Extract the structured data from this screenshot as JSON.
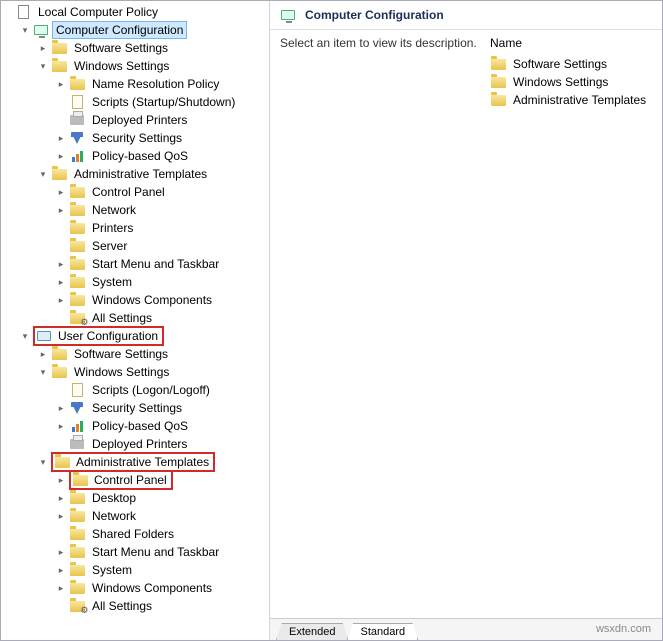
{
  "right_header": {
    "title": "Computer Configuration"
  },
  "right_body": {
    "description_prompt": "Select an item to view its description.",
    "name_header": "Name",
    "items": [
      {
        "label": "Software Settings"
      },
      {
        "label": "Windows Settings"
      },
      {
        "label": "Administrative Templates"
      }
    ]
  },
  "tabs": {
    "extended": "Extended",
    "standard": "Standard"
  },
  "watermark": "wsxdn.com",
  "tree": {
    "root": {
      "label": "Local Computer Policy"
    },
    "computer_config": {
      "label": "Computer Configuration"
    },
    "cc_software": {
      "label": "Software Settings"
    },
    "cc_windows": {
      "label": "Windows Settings"
    },
    "cc_ws_nrp": {
      "label": "Name Resolution Policy"
    },
    "cc_ws_scripts": {
      "label": "Scripts (Startup/Shutdown)"
    },
    "cc_ws_printers": {
      "label": "Deployed Printers"
    },
    "cc_ws_security": {
      "label": "Security Settings"
    },
    "cc_ws_qos": {
      "label": "Policy-based QoS"
    },
    "cc_admin": {
      "label": "Administrative Templates"
    },
    "cc_at_cp": {
      "label": "Control Panel"
    },
    "cc_at_net": {
      "label": "Network"
    },
    "cc_at_prn": {
      "label": "Printers"
    },
    "cc_at_srv": {
      "label": "Server"
    },
    "cc_at_smt": {
      "label": "Start Menu and Taskbar"
    },
    "cc_at_sys": {
      "label": "System"
    },
    "cc_at_wc": {
      "label": "Windows Components"
    },
    "cc_at_all": {
      "label": "All Settings"
    },
    "user_config": {
      "label": "User Configuration"
    },
    "uc_software": {
      "label": "Software Settings"
    },
    "uc_windows": {
      "label": "Windows Settings"
    },
    "uc_ws_scripts": {
      "label": "Scripts (Logon/Logoff)"
    },
    "uc_ws_security": {
      "label": "Security Settings"
    },
    "uc_ws_qos": {
      "label": "Policy-based QoS"
    },
    "uc_ws_printers": {
      "label": "Deployed Printers"
    },
    "uc_admin": {
      "label": "Administrative Templates"
    },
    "uc_at_cp": {
      "label": "Control Panel"
    },
    "uc_at_dt": {
      "label": "Desktop"
    },
    "uc_at_net": {
      "label": "Network"
    },
    "uc_at_sf": {
      "label": "Shared Folders"
    },
    "uc_at_smt": {
      "label": "Start Menu and Taskbar"
    },
    "uc_at_sys": {
      "label": "System"
    },
    "uc_at_wc": {
      "label": "Windows Components"
    },
    "uc_at_all": {
      "label": "All Settings"
    }
  }
}
